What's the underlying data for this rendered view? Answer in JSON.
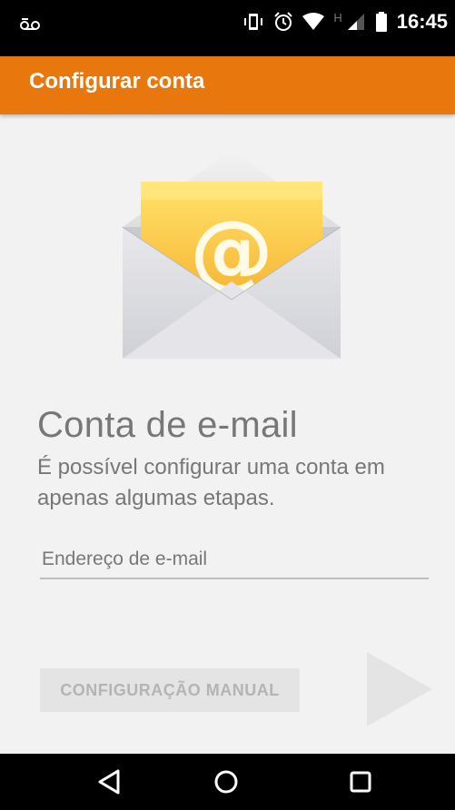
{
  "status_bar": {
    "time": "16:45",
    "network_label": "H",
    "icons": [
      "voicemail-icon",
      "vibrate-icon",
      "alarm-icon",
      "wifi-icon",
      "signal-icon",
      "battery-icon"
    ]
  },
  "app_bar": {
    "title": "Configurar conta",
    "color": "#e8770e"
  },
  "main": {
    "heading": "Conta de e-mail",
    "subtitle": "É possível configurar uma conta em apenas algumas etapas.",
    "email_placeholder": "Endereço de e-mail",
    "email_value": "",
    "manual_button_label": "CONFIGURAÇÃO MANUAL",
    "illustration": "email-envelope-icon"
  },
  "nav_bar": {
    "buttons": [
      "back-icon",
      "home-icon",
      "recents-icon"
    ]
  }
}
